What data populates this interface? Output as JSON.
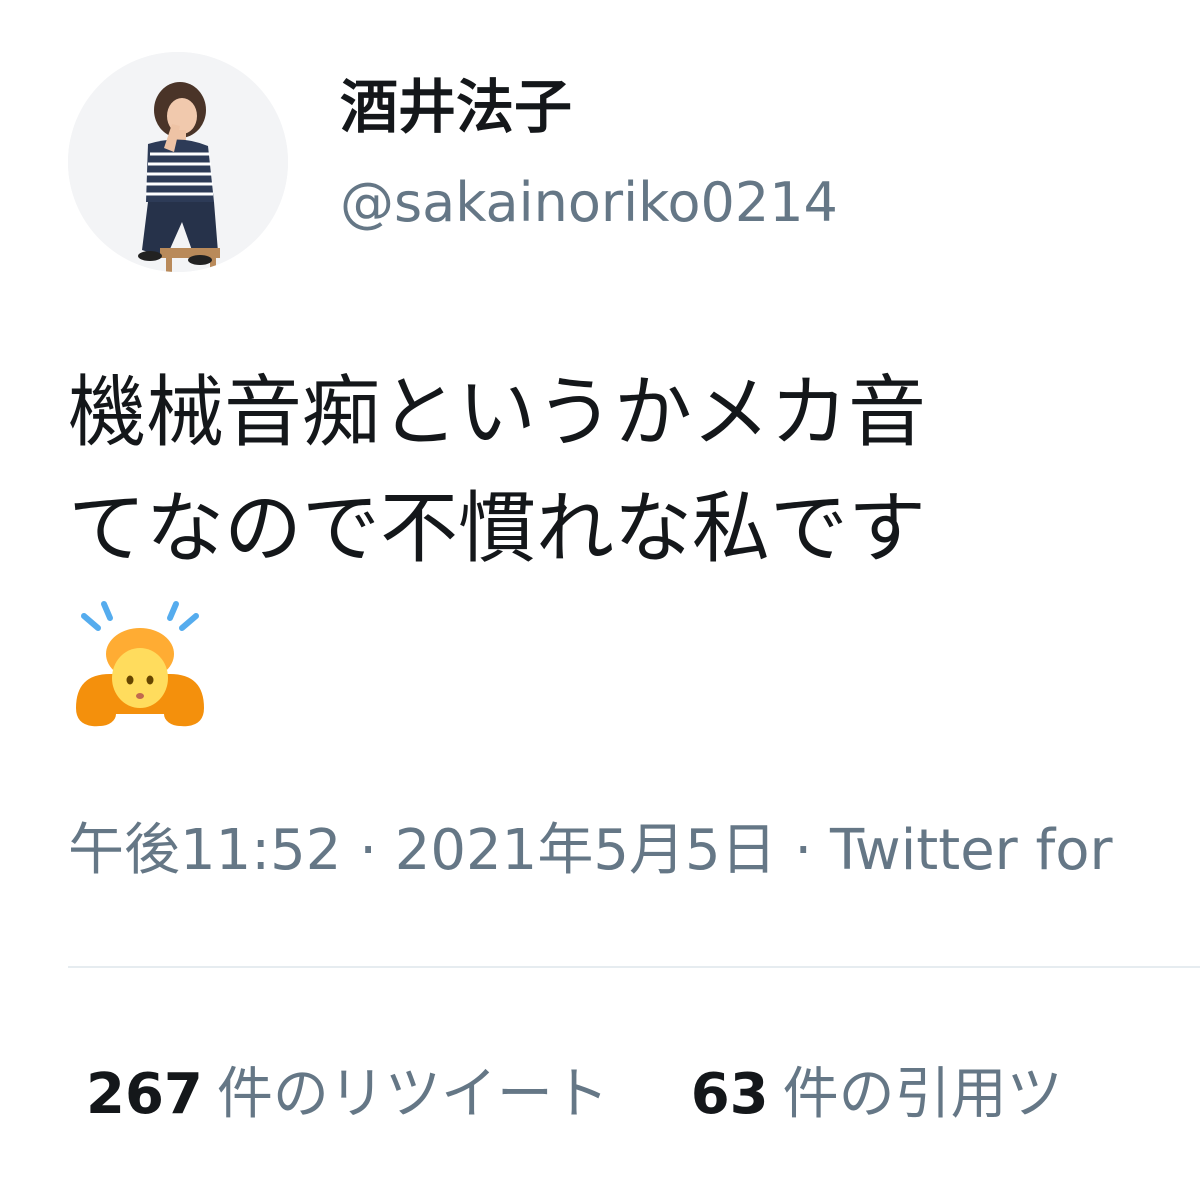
{
  "user": {
    "display_name": "酒井法子",
    "handle": "@sakainoriko0214"
  },
  "tweet": {
    "lines": [
      "機械音痴というかメカ音",
      "てなので不慣れな私です"
    ],
    "emoji_icon": "person-bowing-emoji"
  },
  "meta": {
    "time": "午後11:52",
    "separator_1": " · ",
    "date": "2021年5月5日",
    "separator_2": " · ",
    "source": "Twitter for"
  },
  "stats": {
    "retweets": {
      "count": "267",
      "label": "件のリツイート"
    },
    "quotes": {
      "count": "63",
      "label": "件の引用ツ"
    }
  },
  "colors": {
    "text_primary": "#14171a",
    "text_secondary": "#657786",
    "divider": "#e6ecf0"
  }
}
